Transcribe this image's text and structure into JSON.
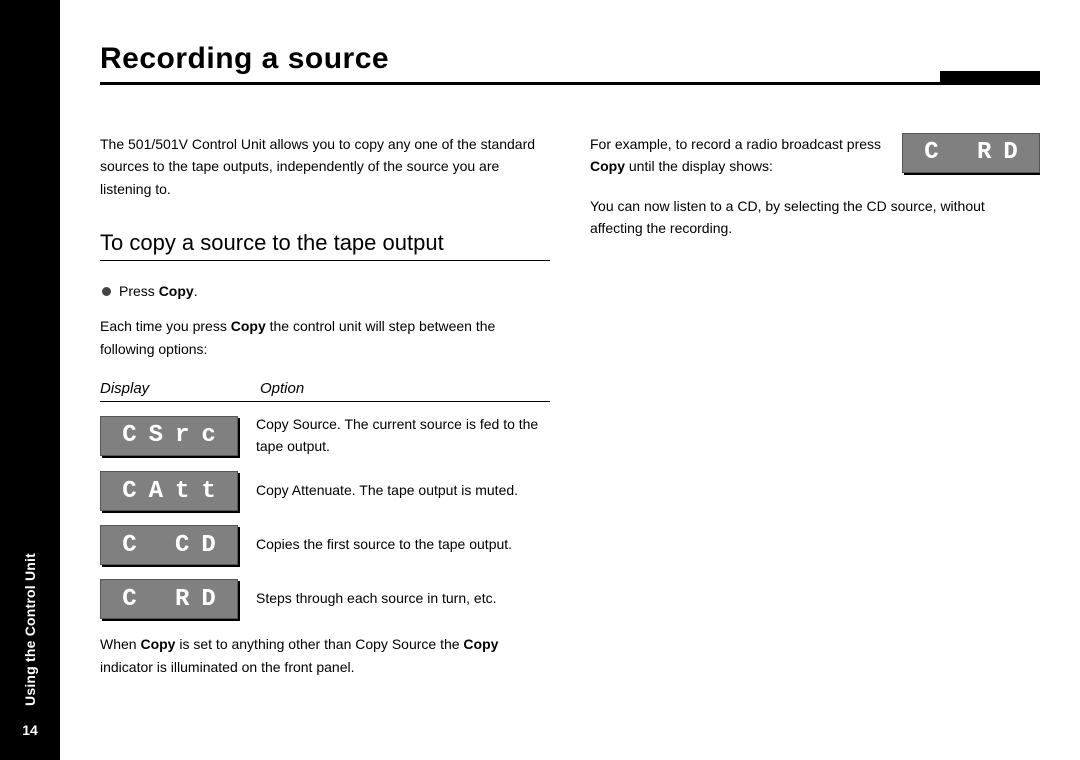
{
  "sidebar": {
    "section_label": "Using the Control Unit",
    "page_number": "14"
  },
  "title": "Recording a source",
  "col1": {
    "intro": "The 501/501V Control Unit allows you to copy any one of the standard sources to the tape outputs, independently of the source you are listening to.",
    "subhead": "To copy a source to the tape output",
    "bullet_press_pre": "Press ",
    "bullet_press_bold": "Copy",
    "bullet_press_post": ".",
    "step_pre": "Each time you press ",
    "step_bold": "Copy",
    "step_post": " the control unit will step between the following options:",
    "th_display": "Display",
    "th_option": "Option",
    "rows": [
      {
        "display": "CSrc",
        "desc": "Copy Source. The current source is fed to the tape output."
      },
      {
        "display": "CAtt",
        "desc": "Copy Attenuate. The tape output is muted."
      },
      {
        "display": "C CD",
        "desc": "Copies the first source to the tape output."
      },
      {
        "display": "C RD",
        "desc": "Steps through each source in turn, etc."
      }
    ],
    "note_pre": "When ",
    "note_b1": "Copy",
    "note_mid": " is set to anything other than Copy Source the ",
    "note_b2": "Copy",
    "note_post": " indicator is illuminated on the front panel."
  },
  "col2": {
    "ex_pre": "For example, to record a radio broadcast press ",
    "ex_bold": "Copy",
    "ex_post": " until the display shows:",
    "ex_lcd": "C RD",
    "listen": "You can now listen to a CD, by selecting the CD source, without affecting the recording."
  }
}
